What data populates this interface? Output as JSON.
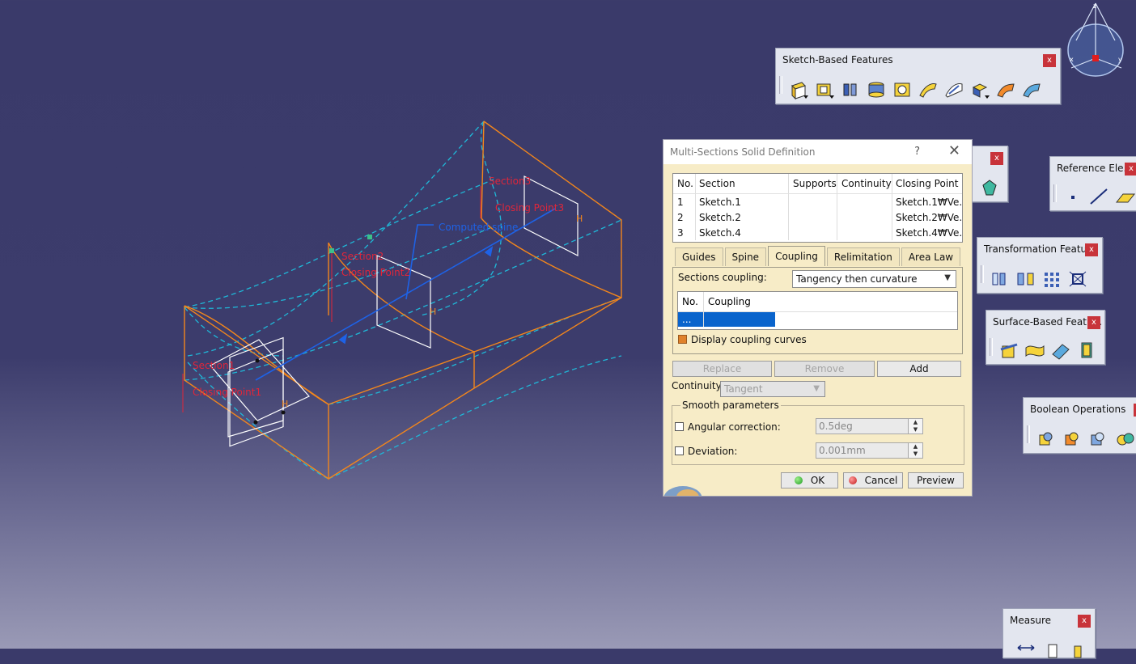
{
  "scene": {
    "labels": {
      "section1": "Section1",
      "closing1": "Closing Point1",
      "section2": "Section2",
      "closing2": "Closing Point2",
      "section3": "Section3",
      "closing3": "Closing Point3",
      "spine": "Computed spine",
      "h": "H"
    },
    "colors": {
      "edge": "#f2861c",
      "guide": "#1fb8d8",
      "spine": "#1e62e6",
      "label": "#e0263a",
      "section": "#ffffff"
    }
  },
  "compass": {
    "axis_z": "z",
    "axis_x": "x",
    "axis_y": "y"
  },
  "toolbars": {
    "sketch_based": {
      "title": "Sketch-Based Features",
      "close": "x",
      "icons": [
        "pad-icon",
        "pocket-icon",
        "shaft-icon",
        "groove-icon",
        "hole-icon",
        "rib-icon",
        "slot-icon",
        "stiffener-icon",
        "multisection-solid-icon",
        "removed-multisection-icon"
      ]
    },
    "hidden_bar": {
      "close": "x"
    },
    "reference": {
      "title": "Reference Ele...",
      "close": "x",
      "icons": [
        "point-icon",
        "line-icon",
        "plane-icon"
      ]
    },
    "transformation": {
      "title": "Transformation Featu...",
      "close": "x",
      "icons": [
        "translation-icon",
        "mirror-icon",
        "pattern-icon",
        "scaling-icon"
      ]
    },
    "surface_based": {
      "title": "Surface-Based Featu...",
      "close": "x",
      "icons": [
        "split-icon",
        "thick-surface-icon",
        "close-surface-icon",
        "sew-surface-icon"
      ]
    },
    "boolean": {
      "title": "Boolean Operations",
      "close": "x",
      "icons": [
        "assemble-icon",
        "add-icon",
        "remove-icon",
        "intersect-icon"
      ]
    },
    "measure": {
      "title": "Measure",
      "close": "x",
      "icons": [
        "measure-between-icon",
        "measure-item-icon",
        "measure-inertia-icon"
      ]
    }
  },
  "dialog": {
    "title": "Multi-Sections Solid Definition",
    "help": "?",
    "close": "✕",
    "table": {
      "headers": [
        "No.",
        "Section",
        "Supports",
        "Continuity",
        "Closing Point"
      ],
      "rows": [
        {
          "no": "1",
          "section": "Sketch.1",
          "supports": "",
          "continuity": "",
          "closing": "Sketch.1₩Ve..."
        },
        {
          "no": "2",
          "section": "Sketch.2",
          "supports": "",
          "continuity": "",
          "closing": "Sketch.2₩Ve..."
        },
        {
          "no": "3",
          "section": "Sketch.4",
          "supports": "",
          "continuity": "",
          "closing": "Sketch.4₩Ve..."
        }
      ]
    },
    "tabs": [
      "Guides",
      "Spine",
      "Coupling",
      "Relimitation",
      "Area Law"
    ],
    "active_tab": "Coupling",
    "coupling": {
      "label": "Sections coupling:",
      "value": "Tangency then curvature",
      "table_headers": [
        "No.",
        "Coupling"
      ],
      "table_row": {
        "no": "...",
        "coupling": ""
      },
      "display_curves": "Display coupling curves"
    },
    "buttons": {
      "replace": "Replace",
      "remove": "Remove",
      "add": "Add"
    },
    "continuity_label": "Continuity:",
    "continuity_value": "Tangent",
    "smooth": {
      "title": "Smooth parameters",
      "angular_label": "Angular correction:",
      "angular_value": "0.5deg",
      "deviation_label": "Deviation:",
      "deviation_value": "0.001mm"
    },
    "footer": {
      "ok": "OK",
      "cancel": "Cancel",
      "preview": "Preview"
    }
  }
}
